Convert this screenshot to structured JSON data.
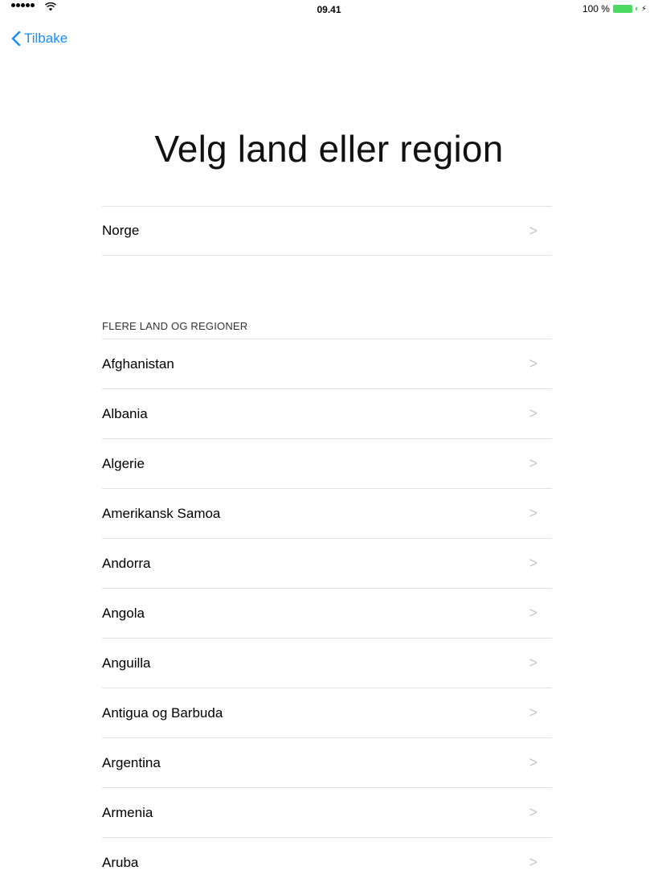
{
  "status_bar": {
    "time": "09.41",
    "battery_percent": "100 %",
    "signal_bars": 5,
    "colors": {
      "battery": "#4cd964"
    }
  },
  "nav": {
    "back_label": "Tilbake",
    "accent": "#1a8cff"
  },
  "title": "Velg land eller region",
  "current_region": {
    "label": "Norge"
  },
  "section_header": "FLERE LAND OG REGIONER",
  "countries": [
    "Afghanistan",
    "Albania",
    "Algerie",
    "Amerikansk Samoa",
    "Andorra",
    "Angola",
    "Anguilla",
    "Antigua og Barbuda",
    "Argentina",
    "Armenia",
    "Aruba"
  ],
  "icons": {
    "row_chevron": "chevron-right-icon",
    "back": "chevron-left-icon"
  }
}
